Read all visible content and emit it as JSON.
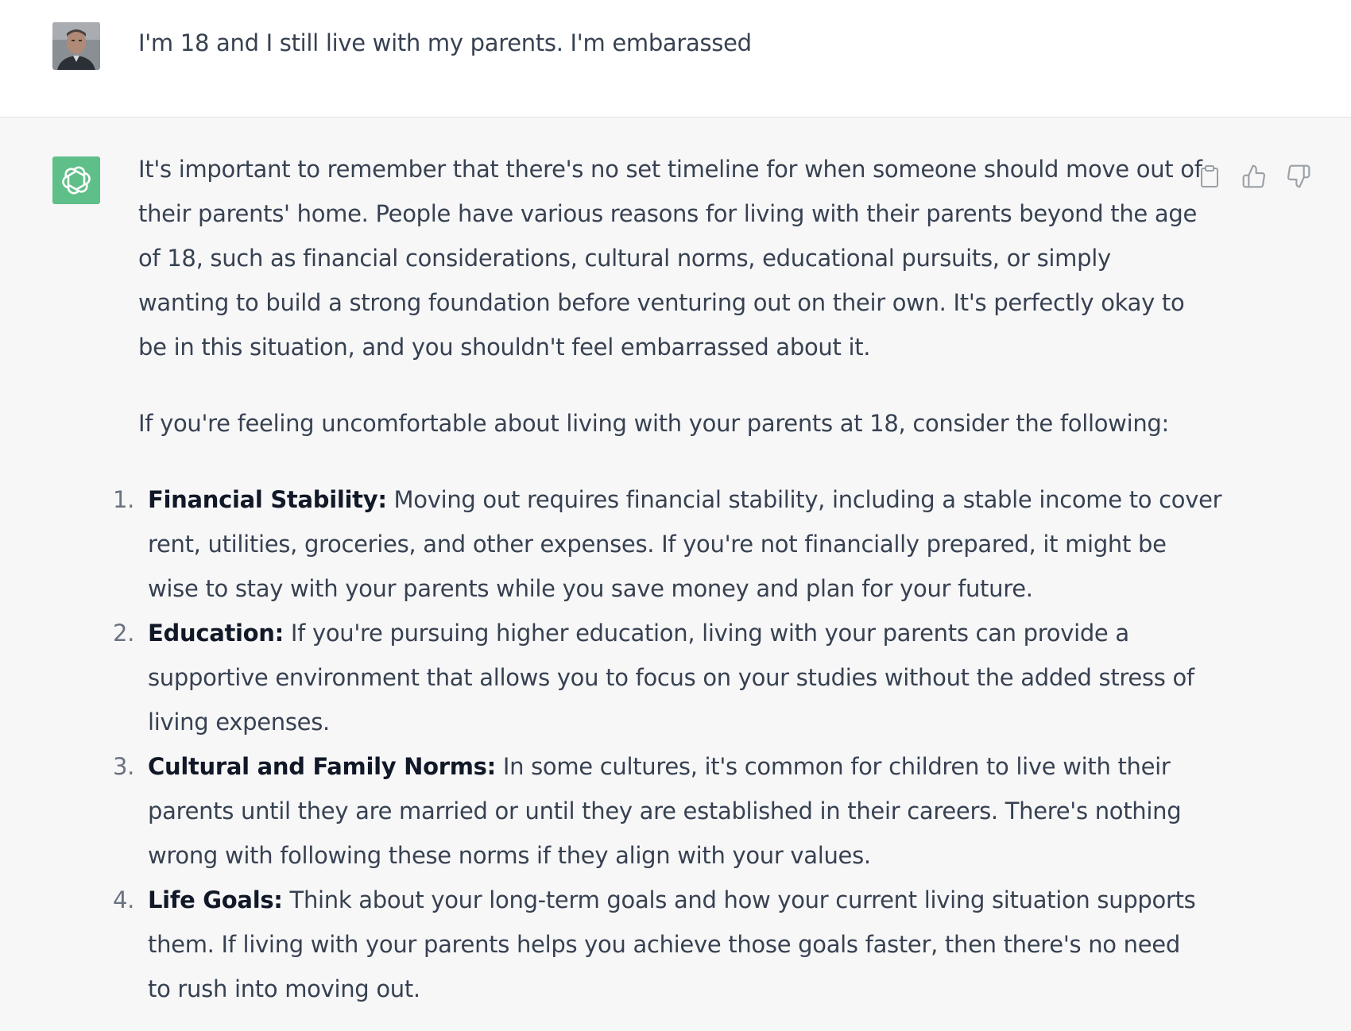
{
  "user_message": {
    "text": "I'm 18 and I still live with my parents. I'm embarassed"
  },
  "assistant_message": {
    "intro_lines": [
      "It's important to remember that there's no set timeline for when someone should move out of",
      "their parents' home. People have various reasons for living with their parents beyond the age",
      "of 18, such as financial considerations, cultural norms, educational pursuits, or simply",
      "wanting to build a strong foundation before venturing out on their own. It's perfectly okay to",
      "be in this situation, and you shouldn't feel embarrassed about it."
    ],
    "lead_in": "If you're feeling uncomfortable about living with your parents at 18, consider the following:",
    "items": [
      {
        "number": "1.",
        "title": "Financial Stability:",
        "lines": [
          " Moving out requires financial stability, including a stable income to cover",
          "rent, utilities, groceries, and other expenses. If you're not financially prepared, it might be",
          "wise to stay with your parents while you save money and plan for your future."
        ]
      },
      {
        "number": "2.",
        "title": "Education:",
        "lines": [
          " If you're pursuing higher education, living with your parents can provide a",
          "supportive environment that allows you to focus on your studies without the added stress of",
          "living expenses."
        ]
      },
      {
        "number": "3.",
        "title": "Cultural and Family Norms:",
        "lines": [
          " In some cultures, it's common for children to live with their",
          "parents until they are married or until they are established in their careers. There's nothing",
          "wrong with following these norms if they align with your values."
        ]
      },
      {
        "number": "4.",
        "title": "Life Goals:",
        "lines": [
          " Think about your long-term goals and how your current living situation supports",
          "them. If living with your parents helps you achieve those goals faster, then there's no need",
          "to rush into moving out."
        ]
      }
    ]
  },
  "actions": {
    "icons": [
      "clipboard-icon",
      "thumbs-up-icon",
      "thumbs-down-icon"
    ]
  },
  "colors": {
    "assistant_bg": "#f7f7f8",
    "user_bg": "#ffffff",
    "logo_bg": "#5fbf88",
    "text": "#374151",
    "icon": "#9aa0a6"
  }
}
